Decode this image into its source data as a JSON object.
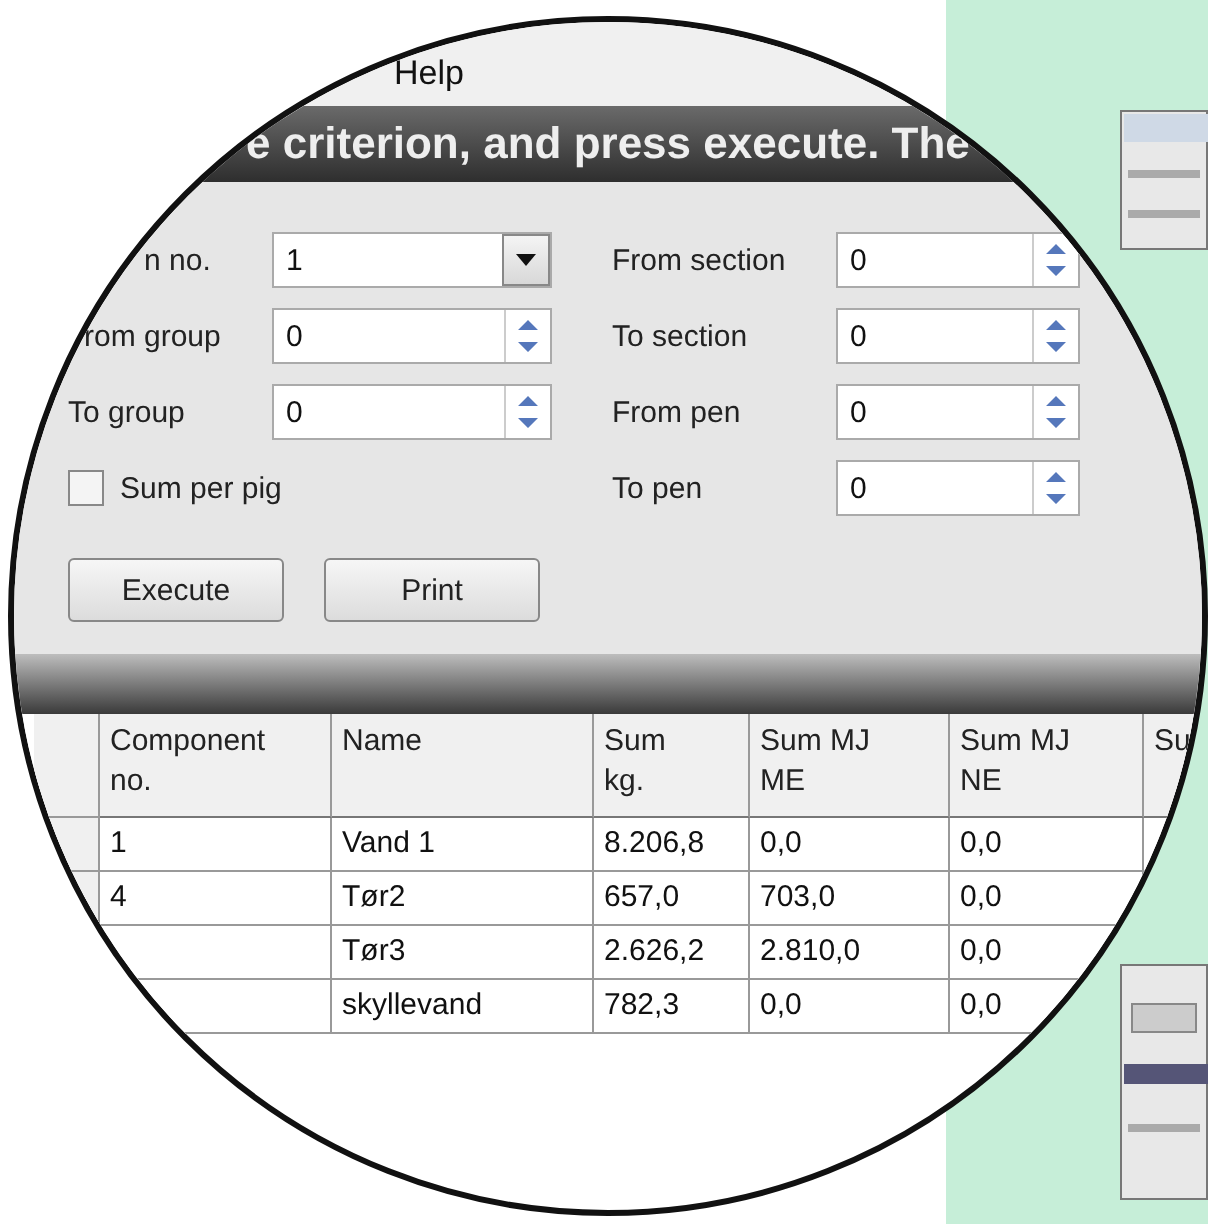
{
  "menu": [
    "Help"
  ],
  "banner": "e criterion, and press execute. The",
  "left_fields": [
    {
      "label": "n no.",
      "kind": "combo",
      "value": "1"
    },
    {
      "label": "rom group",
      "kind": "spin",
      "value": "0"
    },
    {
      "label": "To group",
      "kind": "spin",
      "value": "0"
    }
  ],
  "right_fields": [
    {
      "label": "From section",
      "value": "0"
    },
    {
      "label": "To section",
      "value": "0"
    },
    {
      "label": "From pen",
      "value": "0"
    },
    {
      "label": "To pen",
      "value": "0"
    }
  ],
  "sum_per_pig": {
    "label": "Sum per pig",
    "checked": false
  },
  "buttons": [
    "Execute",
    "Print"
  ],
  "table": {
    "columns": [
      "Component no.",
      "Name",
      "Sum kg.",
      "Sum MJ ME",
      "Sum MJ NE",
      "Su"
    ],
    "rows": [
      [
        "1",
        "Vand 1",
        "8.206,8",
        "0,0",
        "0,0",
        ""
      ],
      [
        "4",
        "Tør2",
        "657,0",
        "703,0",
        "0,0",
        ""
      ],
      [
        "",
        "Tør3",
        "2.626,2",
        "2.810,0",
        "0,0",
        ""
      ],
      [
        "",
        "skyllevand",
        "782,3",
        "0,0",
        "0,0",
        ""
      ]
    ]
  }
}
